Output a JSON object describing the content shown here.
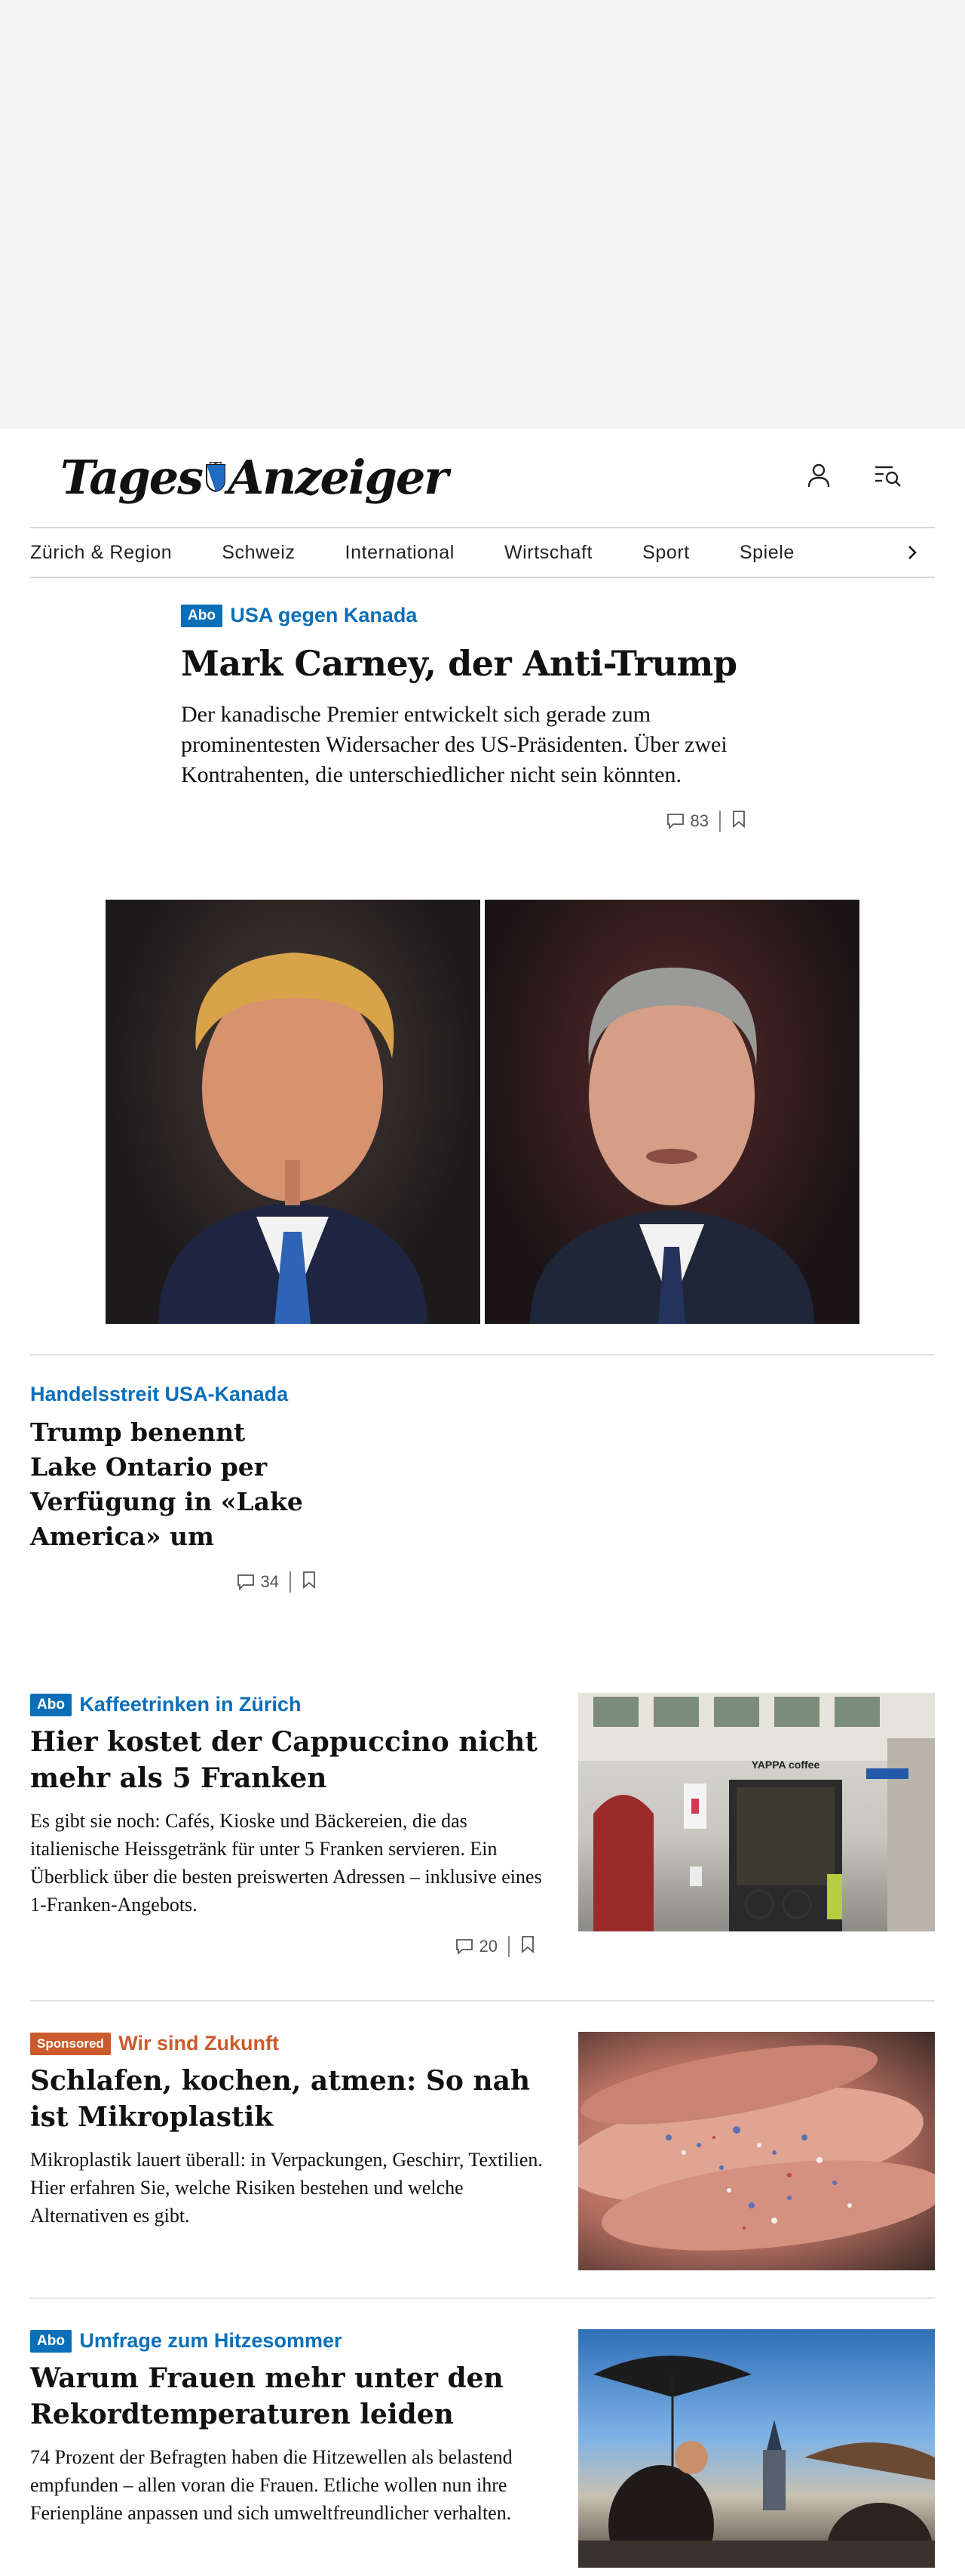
{
  "brand": {
    "logo_text_1": "Tages",
    "logo_text_2": "Anzeiger"
  },
  "header": {
    "icons": [
      "user-icon",
      "menu-search-icon"
    ]
  },
  "nav": {
    "items": [
      "Zürich & Region",
      "Schweiz",
      "International",
      "Wirtschaft",
      "Sport",
      "Spiele"
    ]
  },
  "lead": {
    "badge": "Abo",
    "kicker": "USA gegen Kanada",
    "title": "Mark Carney, der Anti-Trump",
    "lede": "Der kanadische Premier entwickelt sich gerade zum prominentesten Widersacher des US-Präsidenten. Über zwei Kontrahenten, die unterschiedlicher nicht sein könnten.",
    "comments": "83"
  },
  "story2": {
    "kicker": "Handelsstreit USA-Kanada",
    "title": "Trump benennt Lake Ontario per Verfügung in «Lake America» um",
    "comments": "34"
  },
  "teasers": [
    {
      "badge": "Abo",
      "kicker": "Kaffeetrinken in Zürich",
      "title": "Hier kostet der Cappuccino nicht mehr als 5 Franken",
      "lede": "Es gibt sie noch: Cafés, Kioske und Bäckereien, die das italienische Heissgetränk für unter 5 Franken servieren. Ein Überblick über die besten preiswerten Adressen – inklusive eines 1-Franken-Angebots.",
      "comments": "20",
      "photo_sign": "YAPPA coffee"
    },
    {
      "badge": "Sponsored",
      "kicker": "Wir sind Zukunft",
      "title": "Schlafen, kochen, atmen: So nah ist Mikroplastik",
      "lede": "Mikroplastik lauert überall: in Verpackungen, Geschirr, Textilien. Hier erfahren Sie, welche Risiken bestehen und welche Alternativen es gibt."
    },
    {
      "badge": "Abo",
      "kicker": "Umfrage zum Hitzesommer",
      "title": "Warum Frauen mehr unter den Rekordtemperaturen leiden",
      "lede": "74 Prozent der Befragten haben die Hitzewellen als belastend empfunden – allen voran die Frauen. Etliche wollen nun ihre Ferienpläne anpassen und sich umweltfreundlicher verhalten."
    }
  ],
  "colors": {
    "accent": "#0a6fb8",
    "sponsored": "#cb5b2c",
    "ad_background": "#f4f4f4"
  }
}
